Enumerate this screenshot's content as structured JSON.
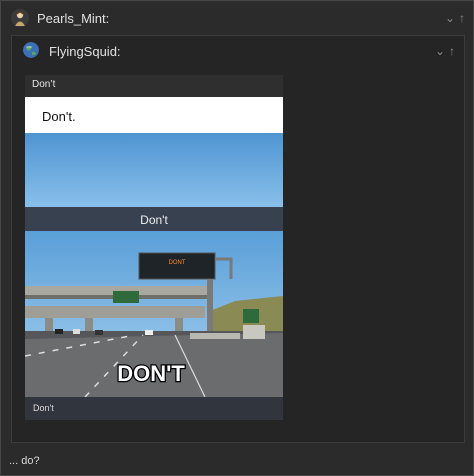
{
  "outer_comment": {
    "username": "Pearls_Mint:",
    "avatar": "user-avatar-icon"
  },
  "inner_comment": {
    "username": "FlyingSquid:",
    "avatar": "globe-avatar-icon"
  },
  "controls": {
    "collapse": "⌄",
    "up": "↑"
  },
  "embed": {
    "title": "Don’t",
    "meme": {
      "top_text": "Don't.",
      "middle_caption": "Don't",
      "sign_text": "DONT",
      "bottom_text": "DON'T"
    },
    "footer": "Don't"
  },
  "reply_text": "... do?",
  "colors": {
    "background": "#2b2b2b",
    "inner": "#252525",
    "caption_bar": "#38414f"
  }
}
